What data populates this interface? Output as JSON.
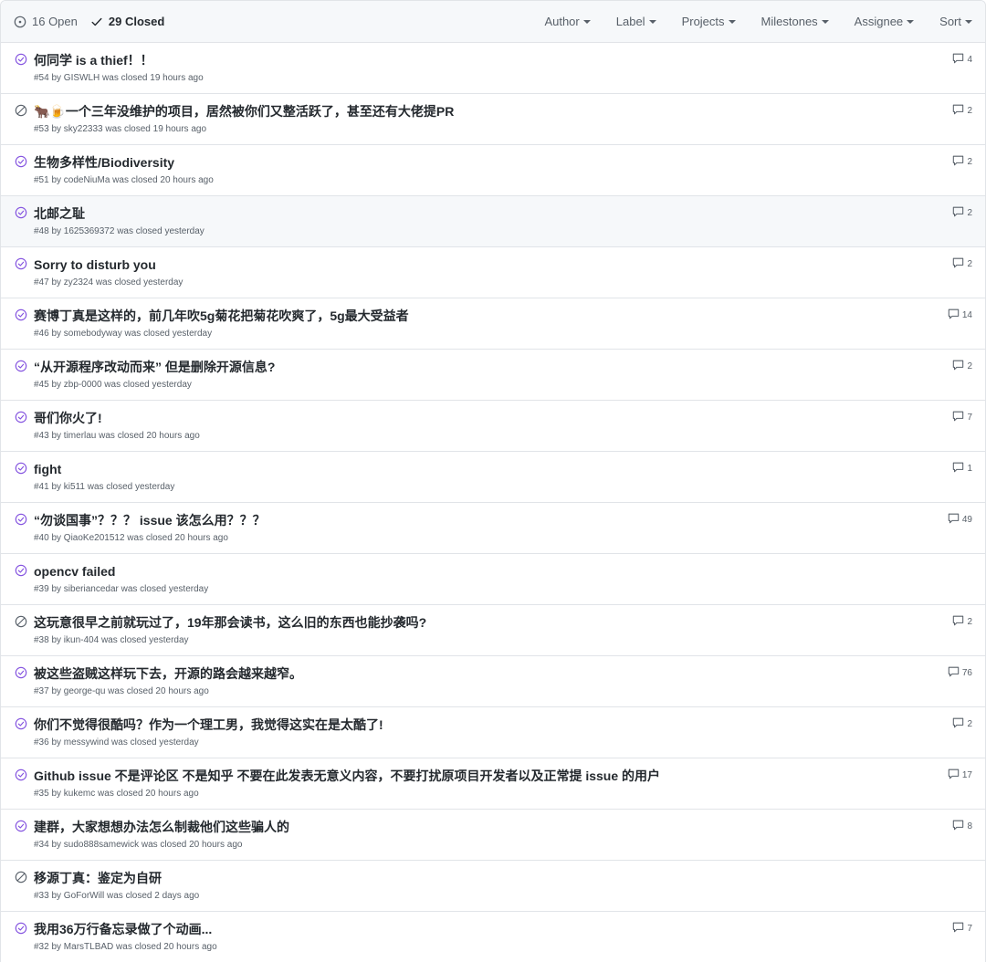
{
  "header": {
    "open_label": "16 Open",
    "closed_label": "29 Closed",
    "filters": [
      {
        "label": "Author",
        "name": "author"
      },
      {
        "label": "Label",
        "name": "label"
      },
      {
        "label": "Projects",
        "name": "projects"
      },
      {
        "label": "Milestones",
        "name": "milestones"
      },
      {
        "label": "Assignee",
        "name": "assignee"
      },
      {
        "label": "Sort",
        "name": "sort"
      }
    ]
  },
  "colors": {
    "completed_purple": "#8250df",
    "not_planned_gray": "#586069",
    "header_bg": "#f6f8fa",
    "border": "#e1e4e8"
  },
  "issues": [
    {
      "title": "何同学 is a thief！！",
      "meta": "#54 by GISWLH was closed 19 hours ago",
      "comments": "4",
      "state": "completed"
    },
    {
      "title": "🐂🍺一个三年没维护的项目，居然被你们又整活跃了，甚至还有大佬提PR",
      "meta": "#53 by sky22333 was closed 19 hours ago",
      "comments": "2",
      "state": "not_planned"
    },
    {
      "title": "生物多样性/Biodiversity",
      "meta": "#51 by codeNiuMa was closed 20 hours ago",
      "comments": "2",
      "state": "completed"
    },
    {
      "title": "北邮之耻",
      "meta": "#48 by 1625369372 was closed yesterday",
      "comments": "2",
      "state": "completed",
      "hover": true
    },
    {
      "title": "Sorry to disturb you",
      "meta": "#47 by zy2324 was closed yesterday",
      "comments": "2",
      "state": "completed"
    },
    {
      "title": "赛博丁真是这样的，前几年吹5g菊花把菊花吹爽了，5g最大受益者",
      "meta": "#46 by somebodyway was closed yesterday",
      "comments": "14",
      "state": "completed"
    },
    {
      "title": "“从开源程序改动而来” 但是删除开源信息?",
      "meta": "#45 by zbp-0000 was closed yesterday",
      "comments": "2",
      "state": "completed"
    },
    {
      "title": "哥们你火了!",
      "meta": "#43 by timerlau was closed 20 hours ago",
      "comments": "7",
      "state": "completed"
    },
    {
      "title": "fight",
      "meta": "#41 by ki511 was closed yesterday",
      "comments": "1",
      "state": "completed"
    },
    {
      "title": "“勿谈国事”？？？ issue 该怎么用？？？",
      "meta": "#40 by QiaoKe201512 was closed 20 hours ago",
      "comments": "49",
      "state": "completed"
    },
    {
      "title": "opencv failed",
      "meta": "#39 by siberiancedar was closed yesterday",
      "comments": "",
      "state": "completed"
    },
    {
      "title": "这玩意很早之前就玩过了，19年那会读书，这么旧的东西也能抄袭吗?",
      "meta": "#38 by ikun-404 was closed yesterday",
      "comments": "2",
      "state": "not_planned"
    },
    {
      "title": "被这些盗贼这样玩下去，开源的路会越来越窄。",
      "meta": "#37 by george-qu was closed 20 hours ago",
      "comments": "76",
      "state": "completed"
    },
    {
      "title": "你们不觉得很酷吗？作为一个理工男，我觉得这实在是太酷了!",
      "meta": "#36 by messywind was closed yesterday",
      "comments": "2",
      "state": "completed"
    },
    {
      "title": "Github issue 不是评论区 不是知乎 不要在此发表无意义内容，不要打扰原项目开发者以及正常提 issue 的用户",
      "meta": "#35 by kukemc was closed 20 hours ago",
      "comments": "17",
      "state": "completed"
    },
    {
      "title": "建群，大家想想办法怎么制裁他们这些骗人的",
      "meta": "#34 by sudo888samewick was closed 20 hours ago",
      "comments": "8",
      "state": "completed"
    },
    {
      "title": "移源丁真：鉴定为自研",
      "meta": "#33 by GoForWill was closed 2 days ago",
      "comments": "",
      "state": "not_planned"
    },
    {
      "title": "我用36万行备忘录做了个动画...",
      "meta": "#32 by MarsTLBAD was closed 20 hours ago",
      "comments": "7",
      "state": "completed"
    }
  ]
}
